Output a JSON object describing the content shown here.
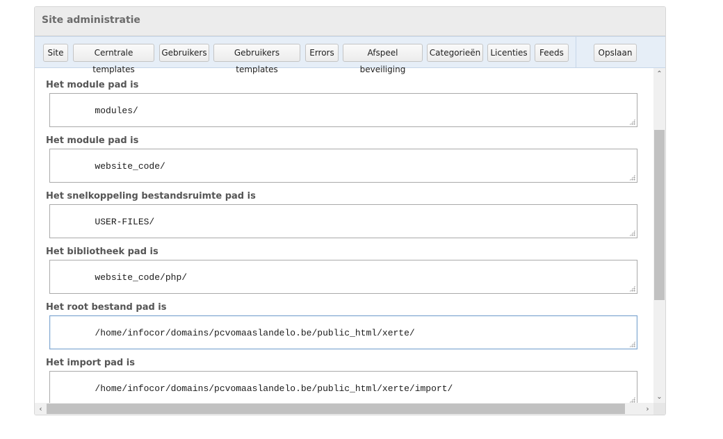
{
  "panel": {
    "title": "Site administratie"
  },
  "toolbar": {
    "tabs": [
      "Site",
      "Cerntrale templates",
      "Gebruikers",
      "Gebruikers templates",
      "Errors",
      "Afspeel beveiliging",
      "Categorieën",
      "Licenties",
      "Feeds"
    ],
    "save_label": "Opslaan"
  },
  "fields": [
    {
      "label": "Het module pad is",
      "value": "modules/"
    },
    {
      "label": "Het module pad is",
      "value": "website_code/"
    },
    {
      "label": "Het snelkoppeling bestandsruimte pad is",
      "value": "USER-FILES/"
    },
    {
      "label": "Het bibliotheek pad is",
      "value": "website_code/php/"
    },
    {
      "label": "Het root bestand pad is",
      "value": "/home/infocor/domains/pcvomaaslandelo.be/public_html/xerte/"
    },
    {
      "label": "Het import pad is",
      "value": "/home/infocor/domains/pcvomaaslandelo.be/public_html/xerte/import/"
    }
  ],
  "icons": {
    "scroll_up": "chevron-up-icon",
    "scroll_down": "chevron-down-icon",
    "scroll_left": "chevron-left-icon",
    "scroll_right": "chevron-right-icon"
  },
  "colors": {
    "header_bg": "#ececec",
    "tabbar_bg": "#e6eef7",
    "focus_border": "#7fa6d0"
  }
}
